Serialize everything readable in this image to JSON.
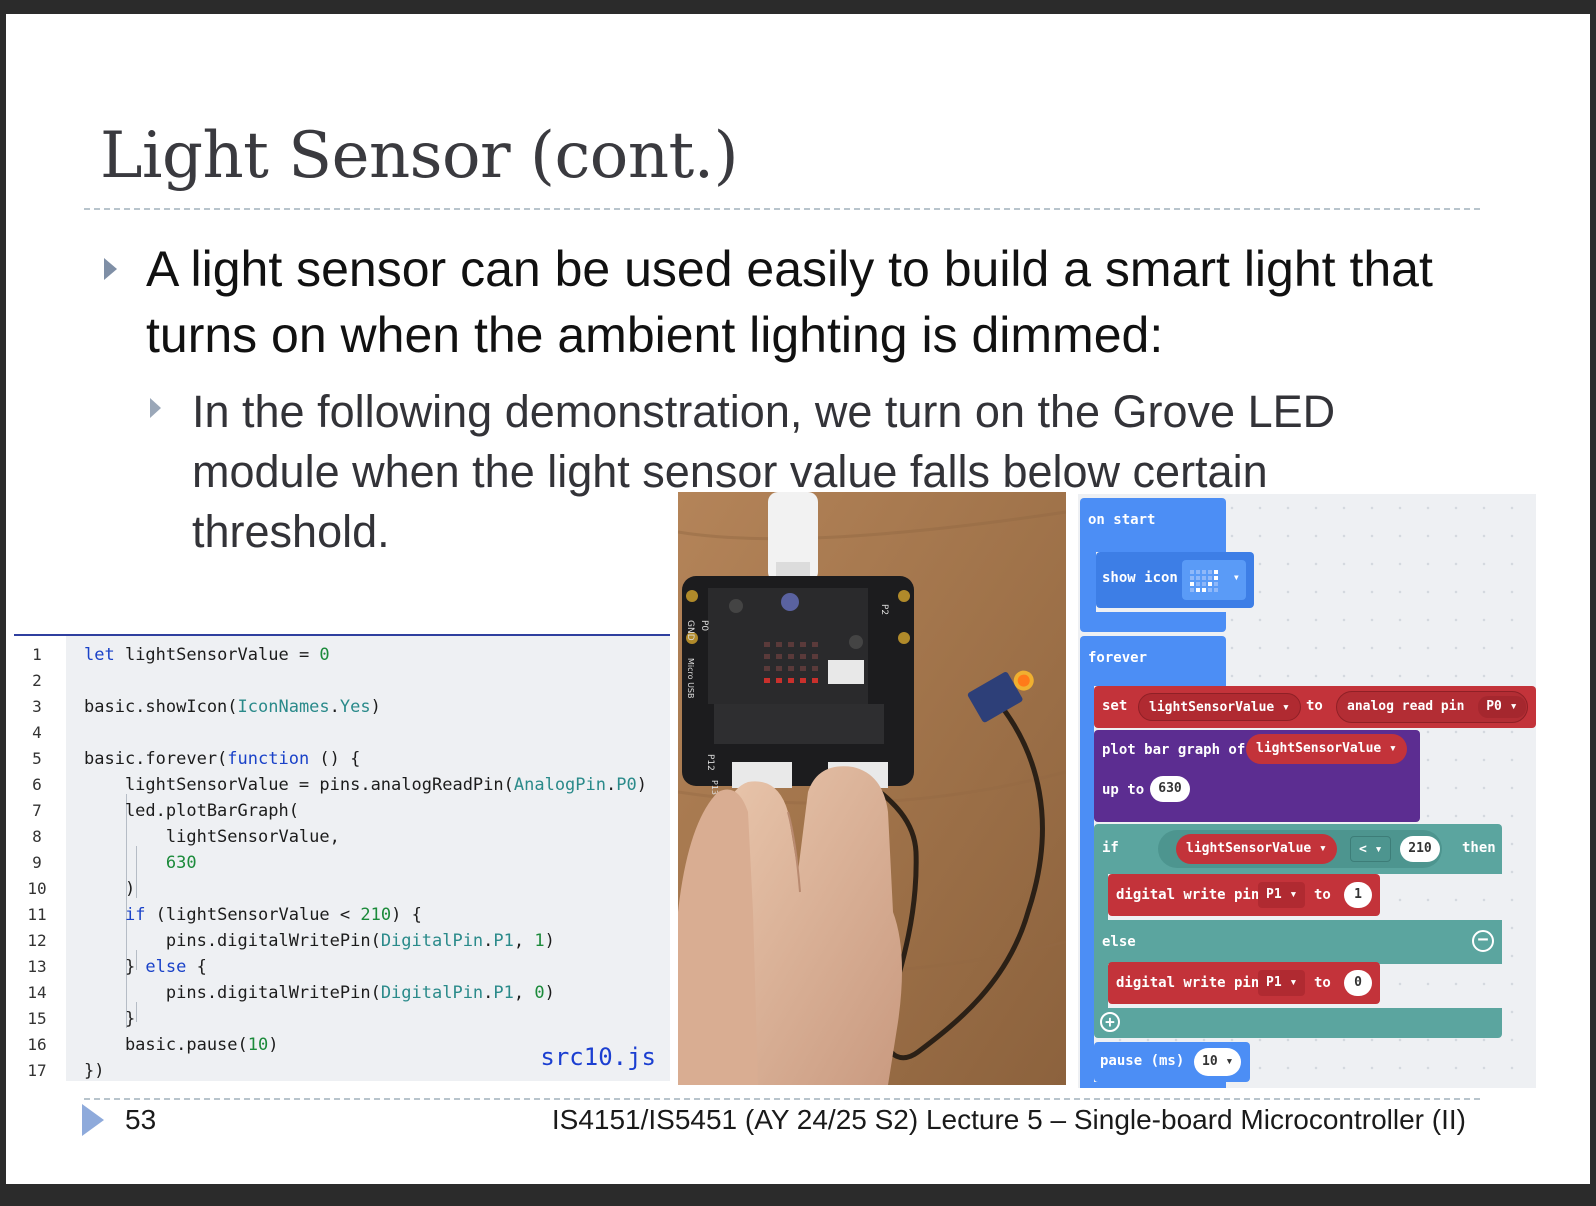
{
  "slide": {
    "title": "Light Sensor (cont.)",
    "bullet1": "A light sensor can be used easily to build a smart light that turns on when the ambient lighting is dimmed:",
    "bullet2": "In the following demonstration, we turn on the Grove LED module when the light sensor value falls below certain threshold."
  },
  "code": {
    "filename": "src10.js",
    "lines": [
      {
        "n": "1",
        "t": "let lightSensorValue = 0"
      },
      {
        "n": "2",
        "t": ""
      },
      {
        "n": "3",
        "t": "basic.showIcon(IconNames.Yes)"
      },
      {
        "n": "4",
        "t": ""
      },
      {
        "n": "5",
        "t": "basic.forever(function () {"
      },
      {
        "n": "6",
        "t": "    lightSensorValue = pins.analogReadPin(AnalogPin.P0)"
      },
      {
        "n": "7",
        "t": "    led.plotBarGraph("
      },
      {
        "n": "8",
        "t": "        lightSensorValue,"
      },
      {
        "n": "9",
        "t": "        630"
      },
      {
        "n": "10",
        "t": "    )"
      },
      {
        "n": "11",
        "t": "    if (lightSensorValue < 210) {"
      },
      {
        "n": "12",
        "t": "        pins.digitalWritePin(DigitalPin.P1, 1)"
      },
      {
        "n": "13",
        "t": "    } else {"
      },
      {
        "n": "14",
        "t": "        pins.digitalWritePin(DigitalPin.P1, 0)"
      },
      {
        "n": "15",
        "t": "    }"
      },
      {
        "n": "16",
        "t": "    basic.pause(10)"
      },
      {
        "n": "17",
        "t": "})"
      }
    ]
  },
  "photo": {
    "board_labels": [
      "GND",
      "P0",
      "Micro USB",
      "P12",
      "P13",
      "P2"
    ]
  },
  "blocks": {
    "on_start": "on start",
    "show_icon": "show icon",
    "forever": "forever",
    "set": "set",
    "set_var": "lightSensorValue",
    "to": "to",
    "analog_read": "analog read pin",
    "analog_pin": "P0",
    "plot_bar": "plot bar graph of",
    "plot_var": "lightSensorValue",
    "up_to": "up to",
    "up_to_val": "630",
    "if": "if",
    "if_var": "lightSensorValue",
    "op": "<",
    "threshold": "210",
    "then": "then",
    "dw1": "digital write pin",
    "dw1_pin": "P1",
    "dw1_to": "to",
    "dw1_val": "1",
    "else": "else",
    "dw2": "digital write pin",
    "dw2_pin": "P1",
    "dw2_to": "to",
    "dw2_val": "0",
    "pause": "pause (ms)",
    "pause_val": "10",
    "colors": {
      "basic": "#4c8ef5",
      "pins": "#c3333a",
      "led": "#5c2d91",
      "logic": "#5ba59f"
    }
  },
  "footer": {
    "page_number": "53",
    "course": "IS4151/IS5451 (AY 24/25 S2) Lecture 5 – Single-board Microcontroller (II)"
  }
}
